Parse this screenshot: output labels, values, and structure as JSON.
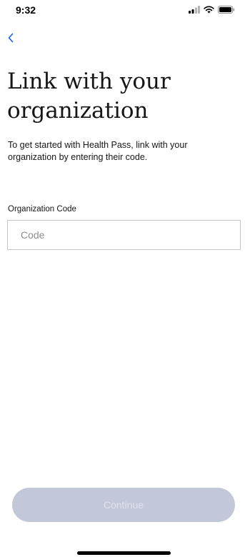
{
  "status_bar": {
    "time": "9:32",
    "icons": [
      "cellular-signal-icon",
      "wifi-icon",
      "battery-icon"
    ]
  },
  "navigation": {
    "back_icon": "chevron-left-icon"
  },
  "main": {
    "title": "Link with your organization",
    "intro": "To get started with Health Pass, link with your organization by entering their code.",
    "field_label": "Organization Code",
    "code_placeholder": "Code",
    "code_value": ""
  },
  "footer": {
    "continue_label": "Continue",
    "continue_enabled": false
  },
  "colors": {
    "accent": "#0f62fe",
    "button_disabled_bg": "#c3c8d9",
    "button_disabled_text": "#dfe2ec",
    "input_border": "#c6c6c6",
    "text_primary": "#161616",
    "placeholder": "#8d8d8d"
  }
}
